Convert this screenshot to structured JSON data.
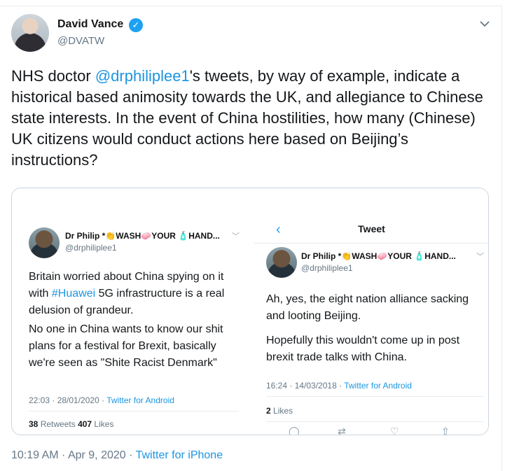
{
  "author": {
    "name": "David Vance",
    "handle": "@DVATW"
  },
  "tweet": {
    "text_before": "NHS doctor ",
    "mention": "@drphiliplee1",
    "text_after": "'s tweets, by way of example, indicate a historical based animosity towards the UK, and allegiance to Chinese state interests. In the event of China hostilities, how many (Chinese) UK citizens would conduct actions here based on Beijing’s instructions?"
  },
  "quoted_left": {
    "name_prefix": "Dr Philip *",
    "name_emoji1": "👏",
    "name_word1": "WASH",
    "name_emoji2": "🧼",
    "name_word2": "YOUR",
    "name_emoji3": "🧴",
    "name_word3": "HAND...",
    "handle": "@drphiliplee1",
    "para1_before": "Britain worried about China spying on it with ",
    "para1_tag": "#Huawei",
    "para1_after": " 5G infrastructure is a real delusion of grandeur.",
    "para2": "No one in China wants to know our shit plans for a festival for Brexit, basically we're seen as \"Shite Racist Denmark\"",
    "time": "22:03 · 28/01/2020 · ",
    "app": "Twitter for Android",
    "retweets_count": "38",
    "retweets_label": " Retweets ",
    "likes_count": "407",
    "likes_label": " Likes"
  },
  "quoted_right": {
    "heading": "Tweet",
    "name_prefix": "Dr Philip *",
    "name_emoji1": "👏",
    "name_word1": "WASH",
    "name_emoji2": "🧼",
    "name_word2": "YOUR",
    "name_emoji3": "🧴",
    "name_word3": "HAND...",
    "handle": "@drphiliplee1",
    "para1": "Ah, yes, the eight nation alliance sacking and looting Beijing.",
    "para2": "Hopefully this wouldn't come up in post brexit trade talks with China.",
    "time": "16:24 · 14/03/2018 · ",
    "app": "Twitter for Android",
    "likes_count": "2",
    "likes_label": " Likes"
  },
  "footer": {
    "timestamp": "10:19 AM · Apr 9, 2020 · ",
    "source": "Twitter for iPhone"
  },
  "colors": {
    "accent": "#1da1f2",
    "link": "#1b95e0",
    "muted": "#657786"
  },
  "icons": [
    "verified-badge-icon",
    "chevron-down-icon",
    "back-arrow-icon",
    "reply-icon",
    "retweet-icon",
    "like-icon",
    "share-icon"
  ]
}
